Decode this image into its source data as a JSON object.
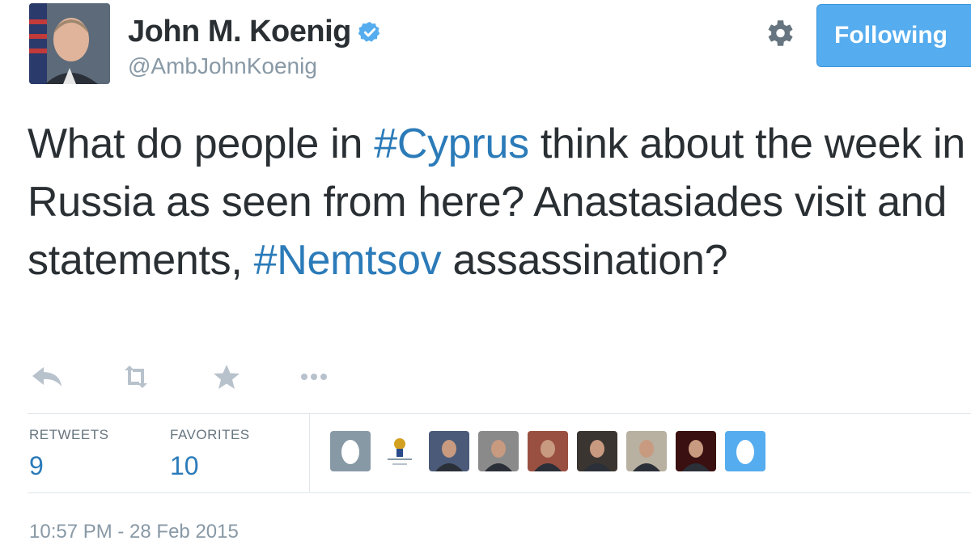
{
  "user": {
    "name": "John M. Koenig",
    "handle": "@AmbJohnKoenig",
    "avatar_icon": "profile-photo",
    "verified_icon": "verified-badge-icon"
  },
  "header": {
    "settings_icon": "gear-icon",
    "follow_button_label": "Following"
  },
  "tweet": {
    "segments": [
      {
        "text": "What do people in ",
        "hashtag": false
      },
      {
        "text": "#Cyprus",
        "hashtag": true
      },
      {
        "text": " think about the week in Russia as seen from here? Anastasiades visit and statements, ",
        "hashtag": false
      },
      {
        "text": "#Nemtsov",
        "hashtag": true
      },
      {
        "text": " assassination?",
        "hashtag": false
      }
    ]
  },
  "actions": [
    {
      "name": "reply-icon"
    },
    {
      "name": "retweet-icon"
    },
    {
      "name": "favorite-star-icon"
    },
    {
      "name": "more-dots-icon"
    }
  ],
  "stats": {
    "retweets_label": "RETWEETS",
    "retweets_count": "9",
    "favorites_label": "FAVORITES",
    "favorites_count": "10"
  },
  "favoriters": [
    {
      "name": "egg-avatar",
      "kind": "egg"
    },
    {
      "name": "emblem-avatar",
      "kind": "emblem"
    },
    {
      "name": "group-photo-avatar",
      "kind": "photo",
      "bg": "#4a5a78"
    },
    {
      "name": "man-photo-avatar",
      "kind": "photo",
      "bg": "#8a8a8a"
    },
    {
      "name": "man-suit-avatar",
      "kind": "photo",
      "bg": "#9a5040"
    },
    {
      "name": "man-dark-avatar",
      "kind": "photo",
      "bg": "#3a3530"
    },
    {
      "name": "man-photo-avatar",
      "kind": "photo",
      "bg": "#b8b0a0"
    },
    {
      "name": "red-photo-avatar",
      "kind": "photo",
      "bg": "#3a1010"
    },
    {
      "name": "egg-avatar",
      "kind": "egg-blue"
    }
  ],
  "timestamp": "10:57 PM - 28 Feb 2015",
  "colors": {
    "link": "#2b7bb9",
    "button": "#55acee",
    "text": "#292f33",
    "muted": "#8899a6"
  }
}
